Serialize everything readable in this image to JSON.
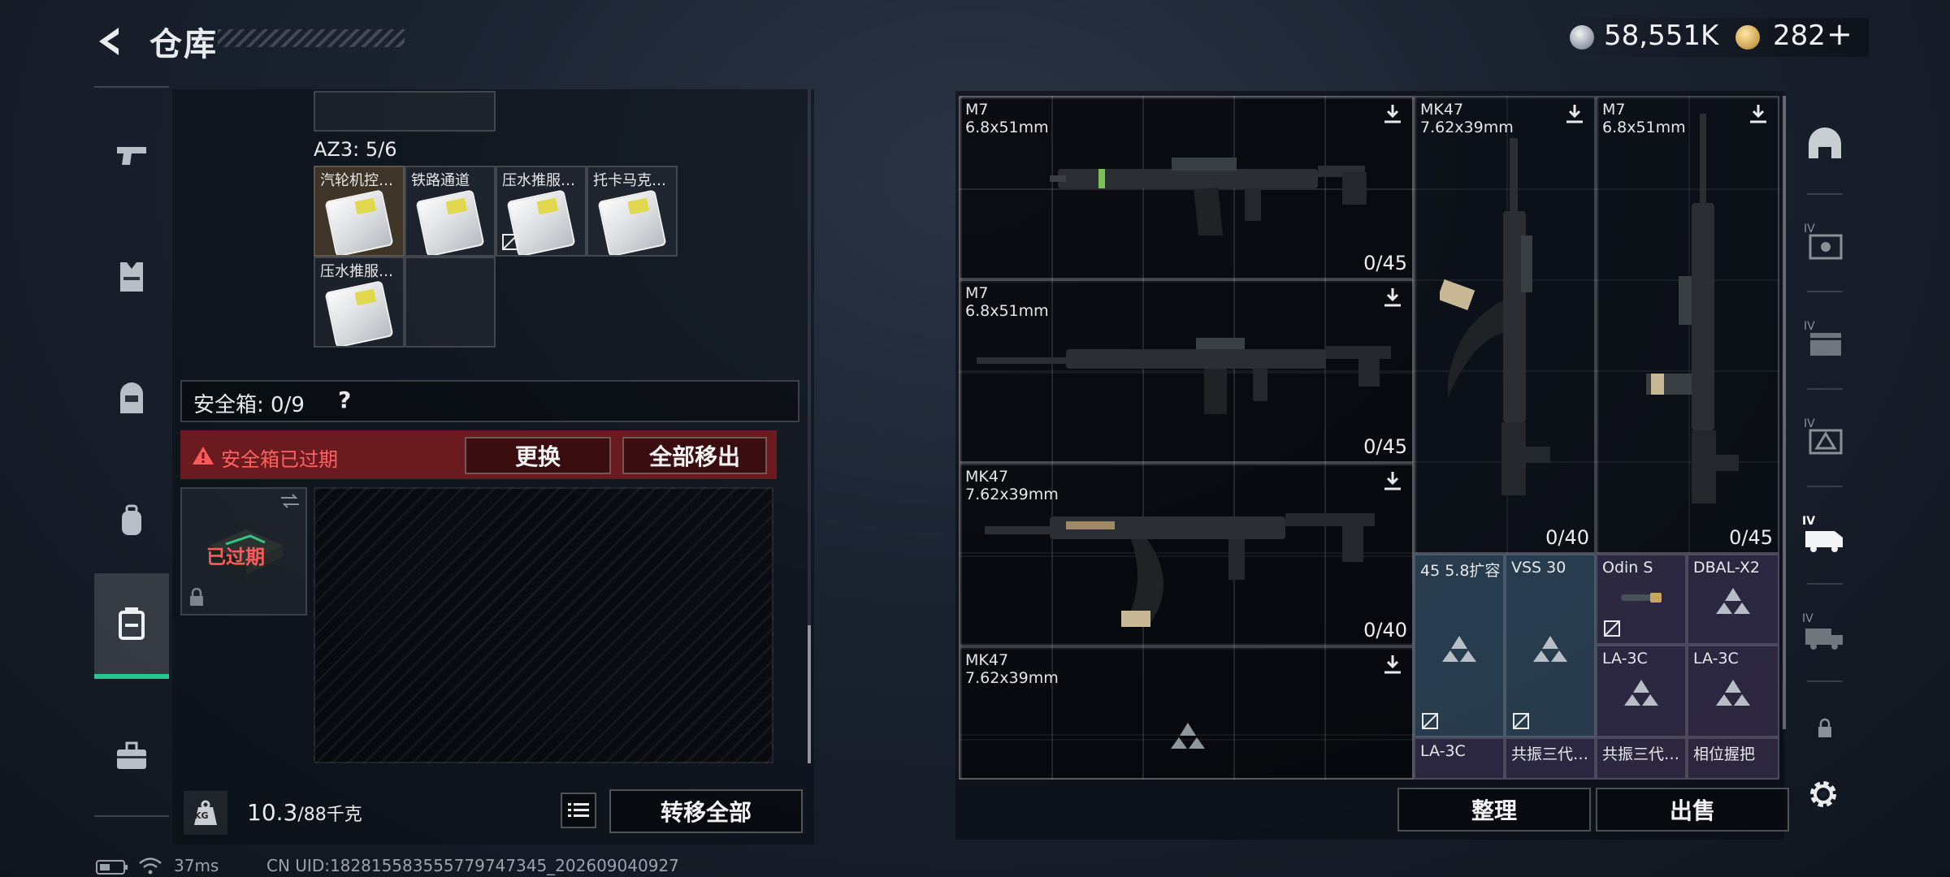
{
  "header": {
    "title": "仓库",
    "currency_silver": "58,551K",
    "currency_gold": "282",
    "gold_add": "+"
  },
  "left_rail": {
    "items": [
      {
        "icon": "pistol-icon"
      },
      {
        "icon": "armor-vest-icon"
      },
      {
        "icon": "helmet-icon"
      },
      {
        "icon": "backpack-icon"
      },
      {
        "icon": "safe-box-icon",
        "active": true
      },
      {
        "icon": "toolbox-icon"
      }
    ]
  },
  "inventory": {
    "section_label": "AZ3: 5/6",
    "items": [
      {
        "label": "汽轮机控…"
      },
      {
        "label": "铁路通道"
      },
      {
        "label": "压水推服…"
      },
      {
        "label": "托卡马克…"
      },
      {
        "label": "压水推服…"
      }
    ]
  },
  "safe_box": {
    "label": "安全箱: 0/9",
    "help": "?",
    "warning": "安全箱已过期",
    "replace_button": "更换",
    "move_all_button": "全部移出",
    "expired_badge": "已过期"
  },
  "footer_left": {
    "weight_current": "10.3",
    "weight_max": "/88千克",
    "weight_icon_label": "KG",
    "transfer_all_button": "转移全部"
  },
  "weapons": [
    {
      "name": "M7",
      "caliber": "6.8x51mm",
      "ammo": "0/45"
    },
    {
      "name": "M7",
      "caliber": "6.8x51mm",
      "ammo": "0/45"
    },
    {
      "name": "MK47",
      "caliber": "7.62x39mm",
      "ammo": "0/40"
    },
    {
      "name": "MK47",
      "caliber": "7.62x39mm",
      "ammo": ""
    },
    {
      "name": "MK47",
      "caliber": "7.62x39mm",
      "ammo": "0/40"
    },
    {
      "name": "M7",
      "caliber": "6.8x51mm",
      "ammo": "0/45"
    }
  ],
  "attachments": [
    {
      "label": "45 5.8扩容",
      "tint": "blue"
    },
    {
      "label": "VSS 30",
      "tint": "blue"
    },
    {
      "label": "Odin S",
      "tint": "purple"
    },
    {
      "label": "DBAL-X2",
      "tint": "purple"
    },
    {
      "label": "LA-3C",
      "tint": "purple"
    },
    {
      "label": "LA-3C",
      "tint": "purple"
    },
    {
      "label": "LA-3C",
      "tint": "purple"
    },
    {
      "label": "共振三代…",
      "tint": "purple"
    },
    {
      "label": "共振三代…",
      "tint": "purple"
    },
    {
      "label": "相位握把",
      "tint": "purple"
    }
  ],
  "right_actions": {
    "sort_button": "整理",
    "sell_button": "出售"
  },
  "right_rail": {
    "items": [
      {
        "icon": "dome-icon"
      },
      {
        "icon": "tier-iv-crate-icon",
        "badge": "IV"
      },
      {
        "icon": "tier-iv-chest-icon",
        "badge": "IV"
      },
      {
        "icon": "tier-iv-box-icon",
        "badge": "IV"
      },
      {
        "icon": "tier-iv-vehicle-icon",
        "badge": "IV",
        "active": true
      },
      {
        "icon": "tier-iv-truck-icon",
        "badge": "IV"
      },
      {
        "icon": "lock-icon"
      },
      {
        "icon": "gear-icon"
      }
    ]
  },
  "status_bar": {
    "ping": "37ms",
    "uid": "CN UID:182815583555779747345_202609040927"
  },
  "colors": {
    "accent_green": "#29c48f",
    "warning_red": "#ff6262",
    "warning_bg": "#6b1b20"
  }
}
